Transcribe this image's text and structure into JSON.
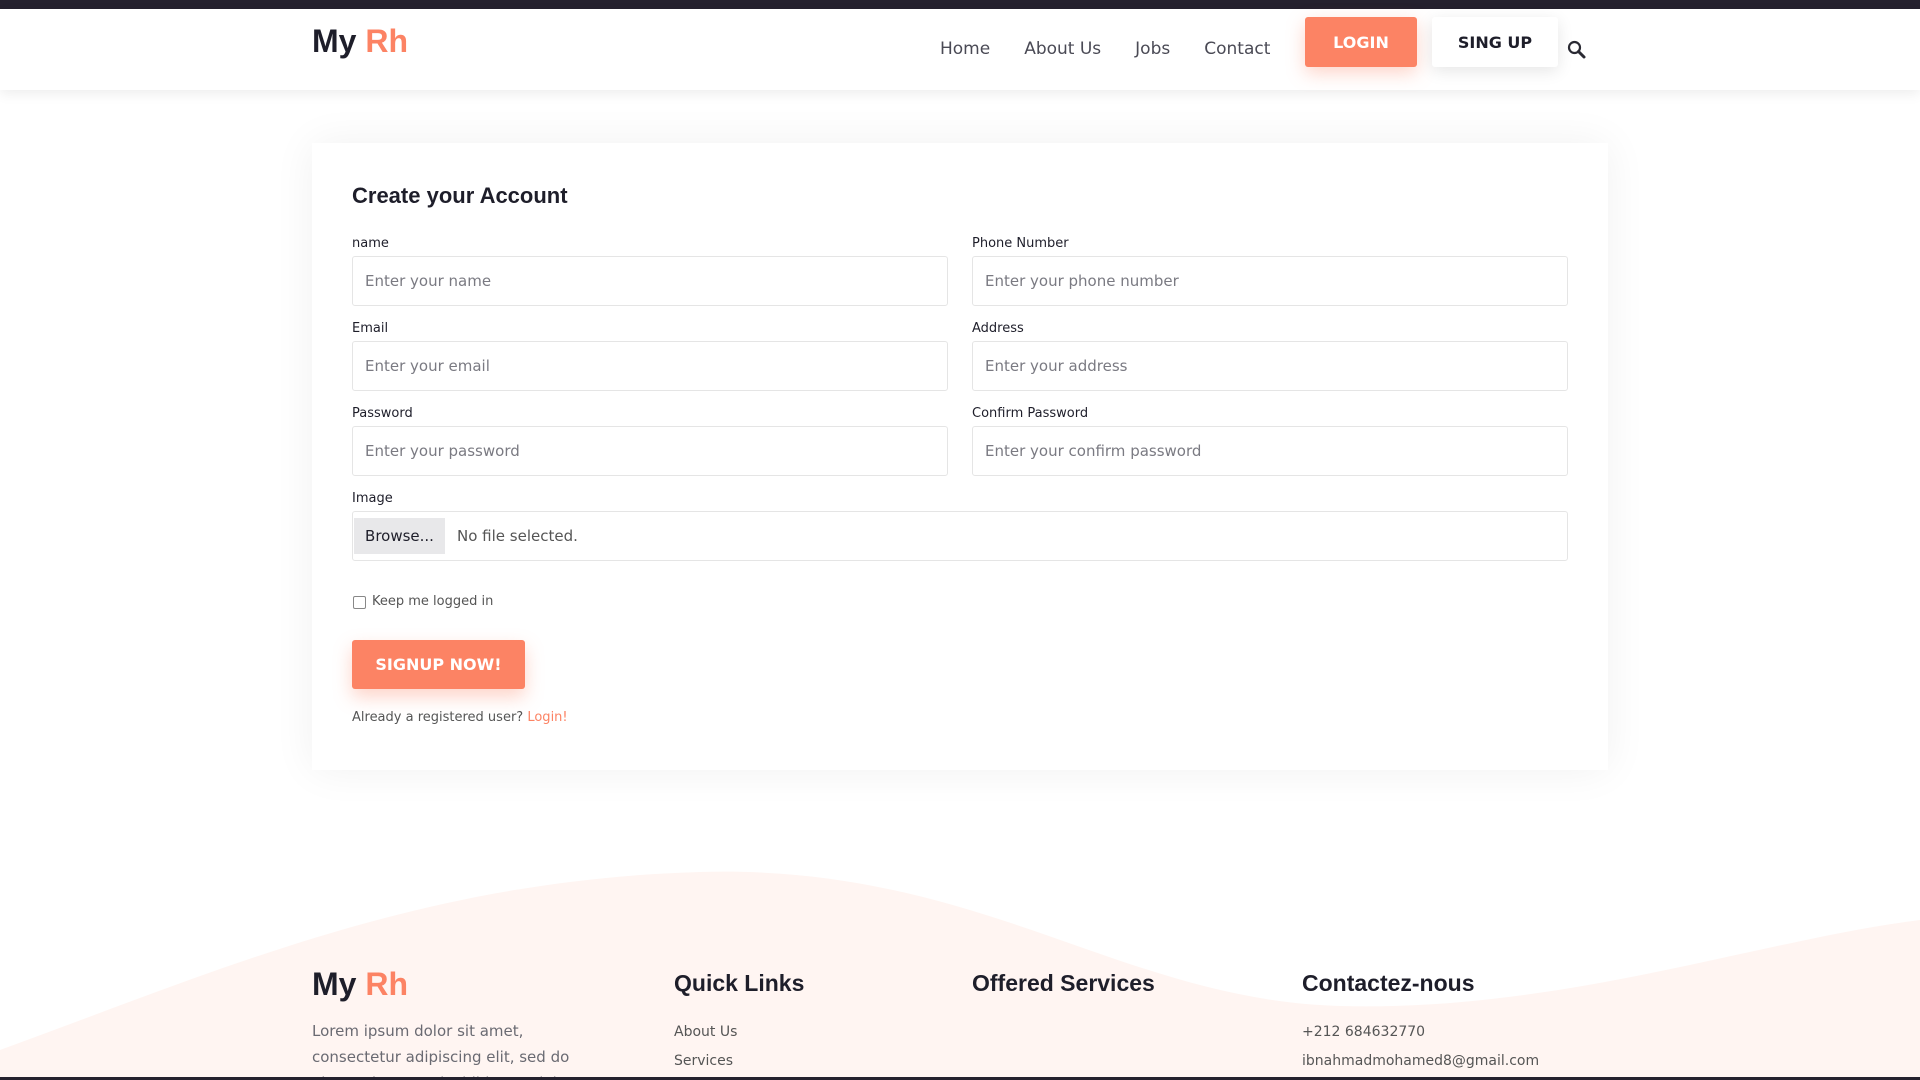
{
  "brand": {
    "prefix": "My",
    "accent": "Rh"
  },
  "nav": {
    "links": [
      "Home",
      "About Us",
      "Jobs",
      "Contact"
    ],
    "login_label": "LOGIN",
    "signup_label": "SING UP",
    "search_icon": "search-icon"
  },
  "form": {
    "title": "Create your Account",
    "fields": {
      "name": {
        "label": "name",
        "placeholder": "Enter your name"
      },
      "phone": {
        "label": "Phone Number",
        "placeholder": "Enter your phone number"
      },
      "email": {
        "label": "Email",
        "placeholder": "Enter your email"
      },
      "address": {
        "label": "Address",
        "placeholder": "Enter your address"
      },
      "password": {
        "label": "Password",
        "placeholder": "Enter your password"
      },
      "confirm": {
        "label": "Confirm Password",
        "placeholder": "Enter your confirm password"
      },
      "image": {
        "label": "Image",
        "browse_label": "Browse...",
        "status": "No file selected."
      }
    },
    "keep_logged_label": "Keep me logged in",
    "submit_label": "SIGNUP NOW!",
    "already_text": "Already a registered user?",
    "login_link": "Login!"
  },
  "footer": {
    "brand": {
      "prefix": "My",
      "accent": "Rh"
    },
    "description": "Lorem ipsum dolor sit amet, consectetur adipiscing elit, sed do eiusmod tempor incididunt ut labore et dolore",
    "quick_links_title": "Quick Links",
    "quick_links": [
      "About Us",
      "Services"
    ],
    "services_title": "Offered Services",
    "contact_title": "Contactez-nous",
    "phone": "+212 684632770",
    "email": "ibnahmadmohamed8@gmail.com"
  },
  "colors": {
    "accent": "#fc8364",
    "dark": "#25212e",
    "footer_wave": "#fff5f2"
  }
}
